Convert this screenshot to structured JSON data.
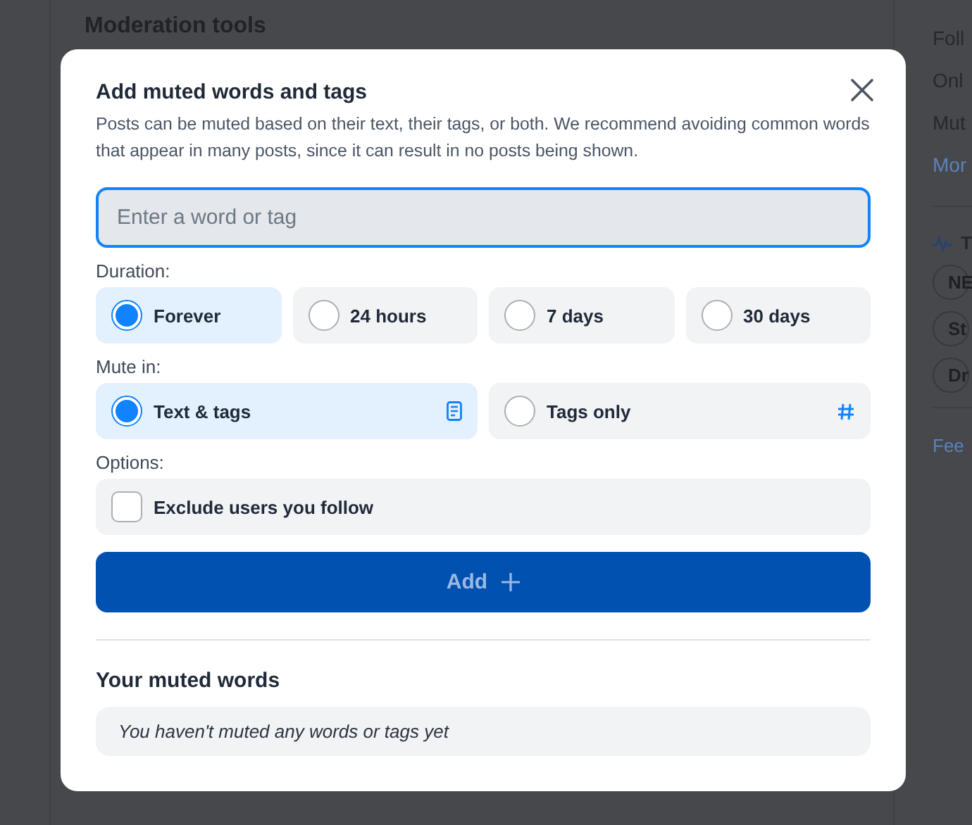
{
  "background": {
    "section_title": "Moderation tools",
    "sidebar_links": [
      "Foll",
      "Onl",
      "Mut"
    ],
    "more_link": "Mor",
    "trending_title": "T",
    "trending_chips": [
      "NE",
      "St",
      "Dr"
    ],
    "feedback_link": "Fee"
  },
  "dialog": {
    "title": "Add muted words and tags",
    "description": "Posts can be muted based on their text, their tags, or both. We recommend avoiding common words that appear in many posts, since it can result in no posts being shown.",
    "input": {
      "placeholder": "Enter a word or tag"
    },
    "duration": {
      "label": "Duration:",
      "options": [
        {
          "label": "Forever",
          "selected": true
        },
        {
          "label": "24 hours",
          "selected": false
        },
        {
          "label": "7 days",
          "selected": false
        },
        {
          "label": "30 days",
          "selected": false
        }
      ]
    },
    "mute_in": {
      "label": "Mute in:",
      "options": [
        {
          "label": "Text & tags",
          "selected": true,
          "kind": "text"
        },
        {
          "label": "Tags only",
          "selected": false,
          "kind": "tags"
        }
      ]
    },
    "options": {
      "label": "Options:",
      "items": [
        {
          "label": "Exclude users you follow",
          "checked": false
        }
      ]
    },
    "add_button": {
      "label": "Add",
      "disabled": true
    },
    "muted_list": {
      "title": "Your muted words",
      "empty_message": "You haven't muted any words or tags yet"
    }
  }
}
